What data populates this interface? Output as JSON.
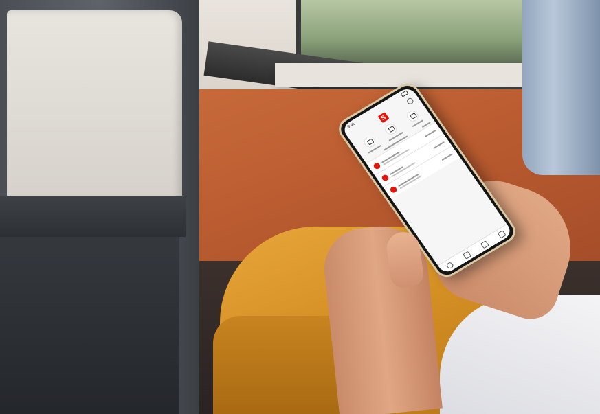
{
  "photo": {
    "subject": "person-using-banking-app-on-smartphone"
  },
  "phone_screen": {
    "status_time": "9:41",
    "logo_glyph": "S",
    "brand_color": "#e3170a",
    "quick_actions": [
      {
        "icon": "transfer-icon",
        "label": ""
      },
      {
        "icon": "camera-icon",
        "label": ""
      },
      {
        "icon": "more-icon",
        "label": ""
      }
    ],
    "section_title": "",
    "accounts": [
      {
        "name": "",
        "subtitle": "",
        "amount": ""
      },
      {
        "name": "",
        "subtitle": "",
        "amount": ""
      },
      {
        "name": "",
        "subtitle": "",
        "amount": ""
      }
    ],
    "nav_icons": [
      "home-icon",
      "accounts-icon",
      "transfer-icon",
      "profile-icon"
    ]
  }
}
